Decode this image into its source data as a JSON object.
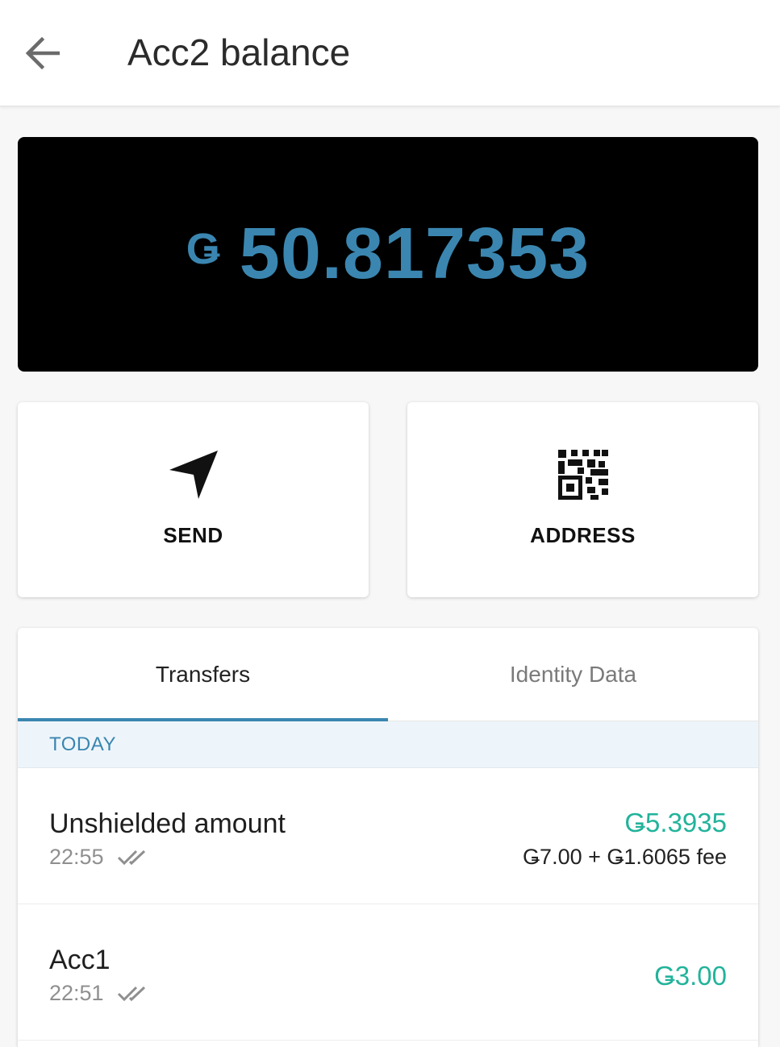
{
  "header": {
    "title": "Acc2 balance"
  },
  "balance": {
    "symbol": "Ǥ",
    "value": "50.817353"
  },
  "actions": {
    "send_label": "SEND",
    "address_label": "ADDRESS"
  },
  "tabs": [
    {
      "label": "Transfers",
      "active": true
    },
    {
      "label": "Identity Data",
      "active": false
    }
  ],
  "section": {
    "label": "TODAY"
  },
  "transfers": [
    {
      "title": "Unshielded amount",
      "time": "22:55",
      "amount": "Ǥ5.3935",
      "detail": "Ǥ7.00 + Ǥ1.6065 fee"
    },
    {
      "title": "Acc1",
      "time": "22:51",
      "amount": "Ǥ3.00"
    }
  ],
  "colors": {
    "accent": "#3a86b0",
    "positive_amount": "#22b39b",
    "balance_background": "#000000"
  },
  "icons": {
    "back": "arrow-left-icon",
    "send": "paper-plane-icon",
    "address": "qr-code-icon",
    "status": "double-check-icon"
  }
}
